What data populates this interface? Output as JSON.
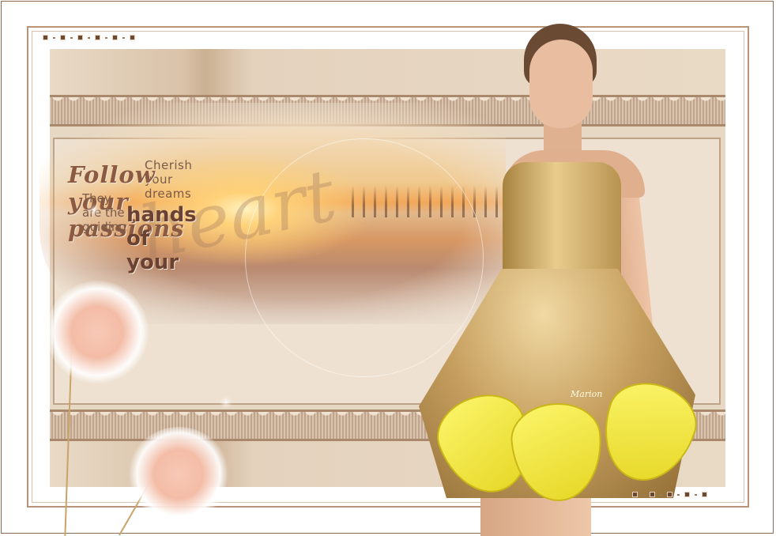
{
  "artwork": {
    "quote": {
      "line1": "Cherish your dreams",
      "line2": "Follow your passions",
      "line3": "They are the guiding",
      "line4": "hands of your",
      "line5": "heart"
    },
    "signature": "Marion"
  },
  "colors": {
    "panel": "#e7d8c4",
    "frame": "#b89378",
    "text_brown": "#8b5a40",
    "dress_gold": "#c7a060",
    "petal_yellow": "#fbf56a"
  }
}
